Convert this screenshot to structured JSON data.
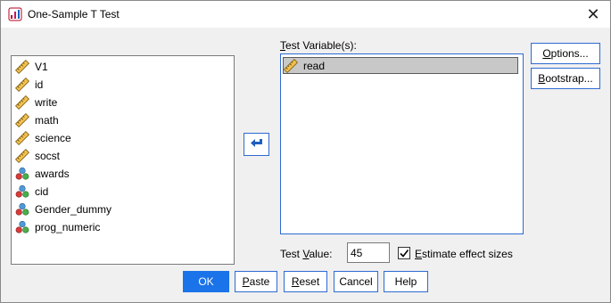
{
  "window": {
    "title": "One-Sample T Test",
    "close_glyph": "✕"
  },
  "source_list": {
    "items": [
      {
        "label": "V1",
        "icon": "scale-ruler-icon"
      },
      {
        "label": "id",
        "icon": "scale-ruler-icon"
      },
      {
        "label": "write",
        "icon": "scale-ruler-icon"
      },
      {
        "label": "math",
        "icon": "scale-ruler-icon"
      },
      {
        "label": "science",
        "icon": "scale-ruler-icon"
      },
      {
        "label": "socst",
        "icon": "scale-ruler-icon"
      },
      {
        "label": "awards",
        "icon": "nominal-icon"
      },
      {
        "label": "cid",
        "icon": "nominal-icon"
      },
      {
        "label": "Gender_dummy",
        "icon": "nominal-icon"
      },
      {
        "label": "prog_numeric",
        "icon": "nominal-icon"
      }
    ]
  },
  "target": {
    "label_pre": "",
    "label_key": "T",
    "label_post": "est Variable(s):",
    "items": [
      {
        "label": "read",
        "icon": "scale-ruler-icon",
        "selected": true
      }
    ]
  },
  "buttons": {
    "options": {
      "pre": "",
      "key": "O",
      "post": "ptions..."
    },
    "bootstrap": {
      "pre": "",
      "key": "B",
      "post": "ootstrap..."
    },
    "ok": "OK",
    "paste": {
      "pre": "",
      "key": "P",
      "post": "aste"
    },
    "reset": {
      "pre": "",
      "key": "R",
      "post": "eset"
    },
    "cancel": "Cancel",
    "help": "Help"
  },
  "test_value": {
    "label_pre": "Test ",
    "label_key": "V",
    "label_post": "alue:",
    "value": "45"
  },
  "effect_sizes": {
    "checked": true,
    "label_pre": "",
    "label_key": "E",
    "label_post": "stimate effect sizes"
  },
  "colors": {
    "accent": "#2e6ad1",
    "ok_bg": "#1a73e8",
    "selection": "#c8c8c8"
  }
}
